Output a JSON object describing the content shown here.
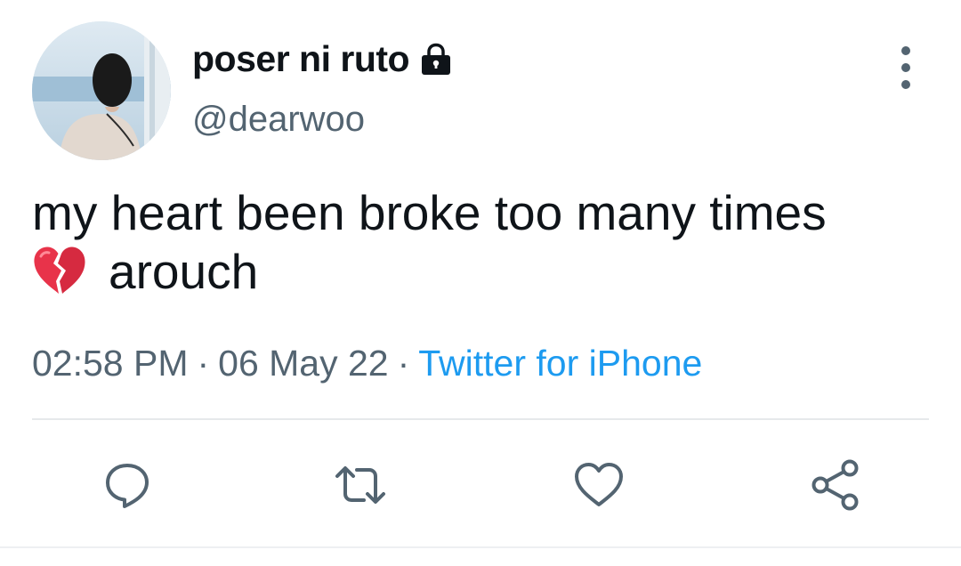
{
  "user": {
    "display_name": "poser ni ruto",
    "handle": "@dearwoo",
    "protected_icon": "lock-icon"
  },
  "tweet": {
    "line1": "my heart been broke too many times",
    "emoji": "broken-heart-emoji",
    "line2": "arouch"
  },
  "meta": {
    "time": "02:58 PM",
    "separator": "·",
    "date": "06 May 22",
    "source": "Twitter for iPhone"
  },
  "actions": [
    "reply-icon",
    "retweet-icon",
    "like-icon",
    "share-icon"
  ],
  "colors": {
    "text": "#0f1419",
    "secondary": "#536471",
    "link": "#1d9bf0",
    "icon": "#536471"
  }
}
